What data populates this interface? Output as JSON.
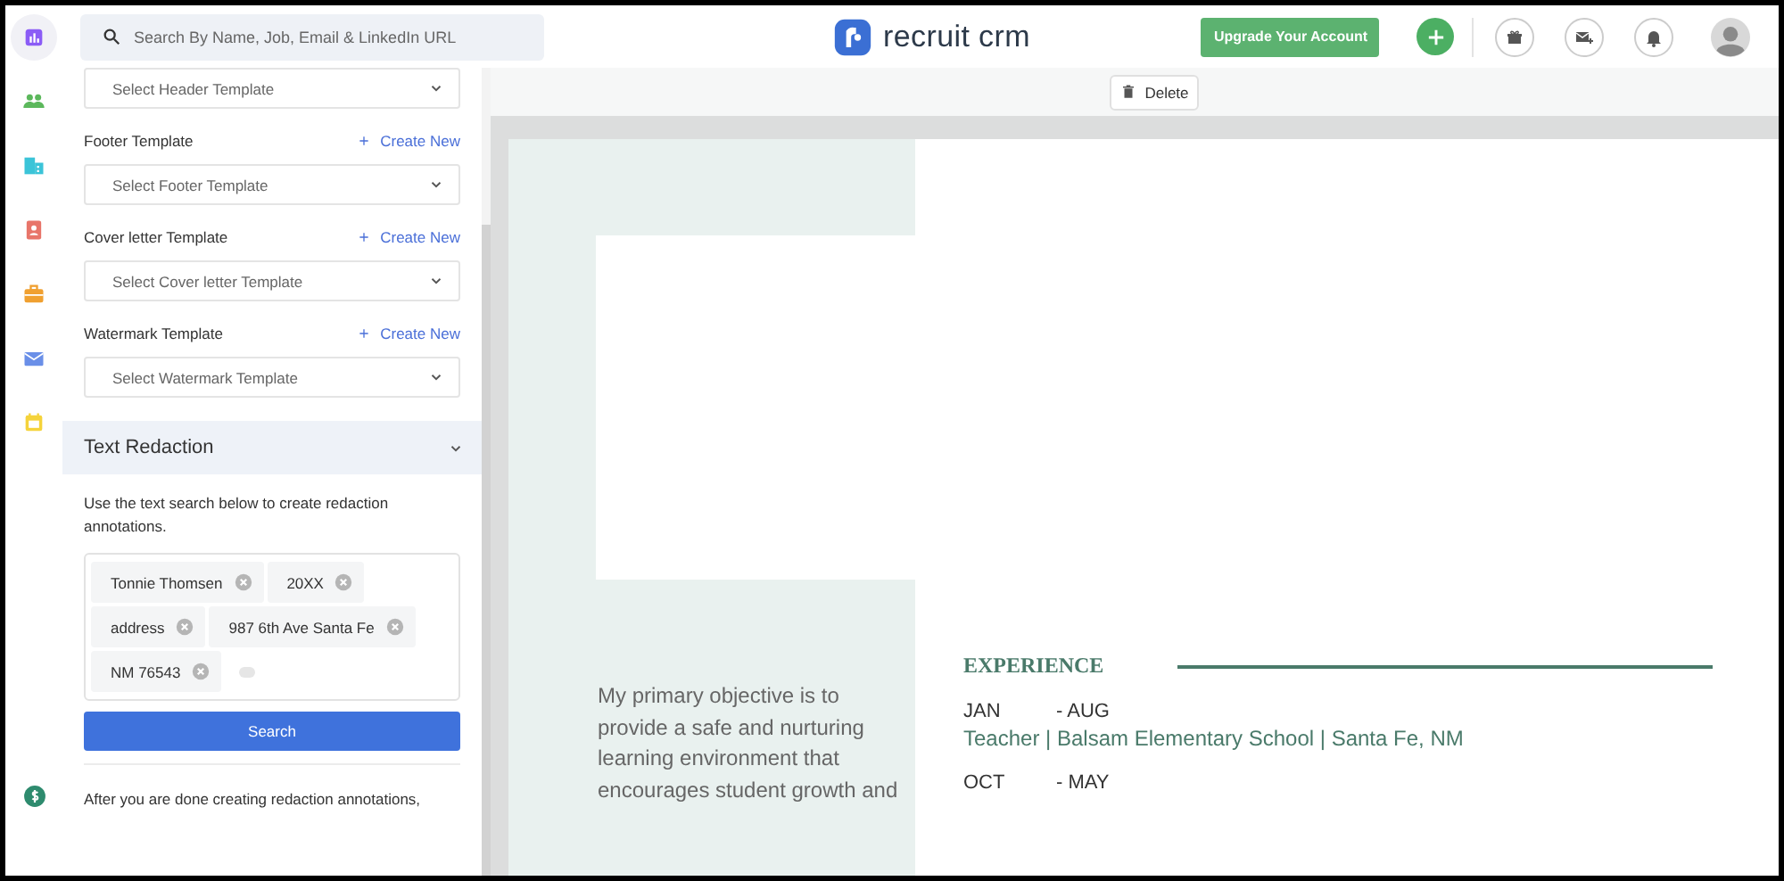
{
  "search": {
    "placeholder": "Search By Name, Job, Email & LinkedIn URL"
  },
  "logo": {
    "text": "recruit crm"
  },
  "header": {
    "upgrade_button": "Upgrade Your Account"
  },
  "rail": [
    {
      "kind": "reports",
      "selected": true
    },
    {
      "kind": "people",
      "selected": false
    },
    {
      "kind": "companies",
      "selected": false
    },
    {
      "kind": "contacts",
      "selected": false
    },
    {
      "kind": "jobs",
      "selected": false
    },
    {
      "kind": "mail",
      "selected": false
    },
    {
      "kind": "calendar",
      "selected": false
    }
  ],
  "templates": [
    {
      "placeholder": "Select Header Template"
    },
    {
      "label": "Footer Template",
      "action": "Create New",
      "placeholder": "Select Footer Template"
    },
    {
      "label": "Cover letter Template",
      "action": "Create New",
      "placeholder": "Select Cover letter Template"
    },
    {
      "label": "Watermark Template",
      "action": "Create New",
      "placeholder": "Select Watermark Template"
    }
  ],
  "text_redaction": {
    "title": "Text Redaction",
    "expanded": true,
    "instructions": "Use the text search below to create redaction annotations.",
    "tags": [
      "Tonnie Thomsen",
      "20XX",
      "address",
      "987 6th Ave Santa Fe",
      "NM 76543"
    ],
    "search_button": "Search",
    "after_text": "After you are done creating redaction annotations,"
  },
  "toolbar": {
    "delete_button": "Delete"
  },
  "resume": {
    "objective": "My primary objective is to provide a safe and nurturing learning environment that encourages student growth and",
    "section_title": "EXPERIENCE",
    "jobs": [
      {
        "from": "JAN",
        "to": "- AUG",
        "role": "Teacher | Balsam Elementary School | Santa Fe, NM"
      },
      {
        "from": "OCT",
        "to": "- MAY"
      }
    ]
  }
}
